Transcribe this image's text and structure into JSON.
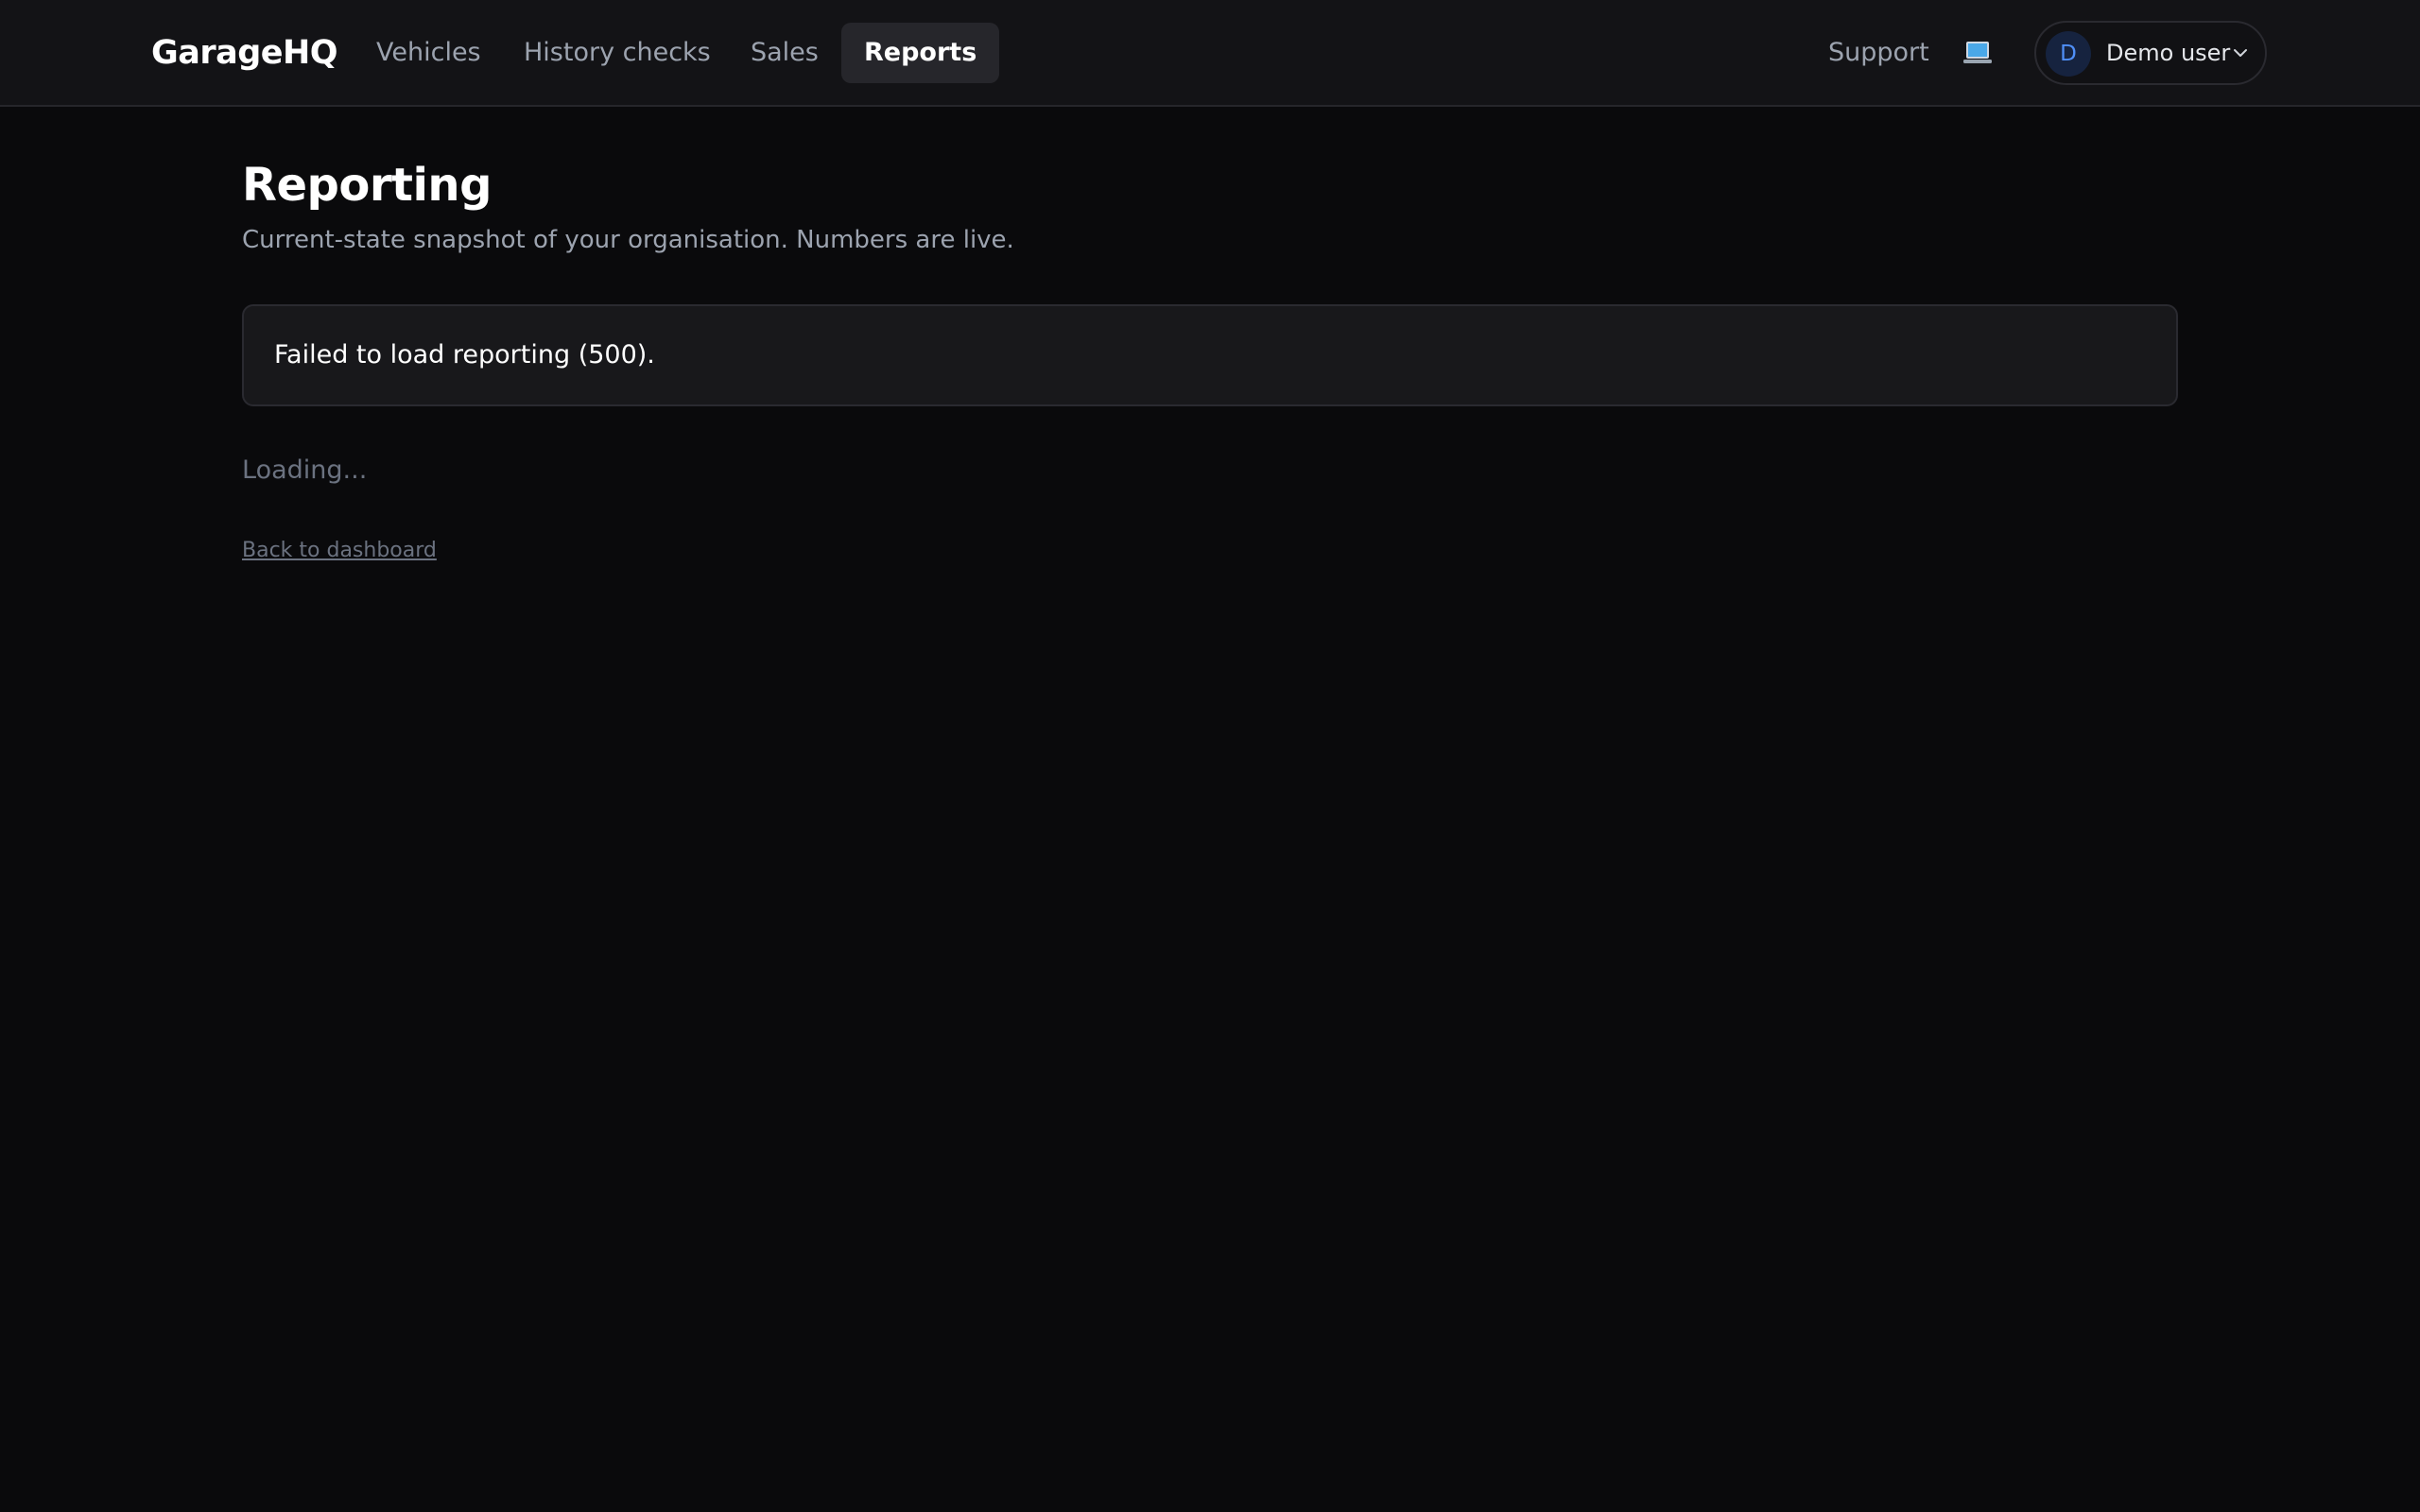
{
  "header": {
    "brand": "GarageHQ",
    "nav": [
      {
        "label": "Vehicles",
        "active": false
      },
      {
        "label": "History checks",
        "active": false
      },
      {
        "label": "Sales",
        "active": false
      },
      {
        "label": "Reports",
        "active": true
      }
    ],
    "support_label": "Support",
    "theme_icon": "laptop-icon",
    "user": {
      "initial": "D",
      "name": "Demo user",
      "menu_icon": "chevron-down-icon"
    }
  },
  "main": {
    "title": "Reporting",
    "subtitle": "Current-state snapshot of your organisation. Numbers are live.",
    "error_message": "Failed to load reporting (500).",
    "loading_text": "Loading...",
    "back_link": "Back to dashboard"
  },
  "colors": {
    "background": "#0a0a0c",
    "topbar": "#131316",
    "card": "#18181b",
    "border": "#2a2a30",
    "text_primary": "#ffffff",
    "text_muted": "#9ca3af",
    "text_faint": "#6b7280",
    "avatar_bg": "#16233f",
    "avatar_text": "#4f8ff7"
  }
}
